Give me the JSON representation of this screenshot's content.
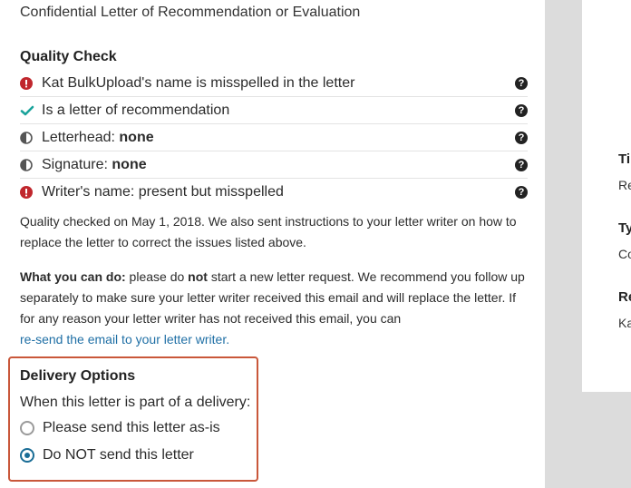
{
  "document": {
    "title": "Confidential Letter of Recommendation or Evaluation"
  },
  "quality_check": {
    "heading": "Quality Check",
    "items": [
      {
        "status": "error",
        "icon": "error-icon",
        "label": "Kat BulkUpload's name is misspelled in the letter",
        "value": ""
      },
      {
        "status": "ok",
        "icon": "checkmark-icon",
        "label": "Is a letter of recommendation",
        "value": ""
      },
      {
        "status": "neutral",
        "icon": "half-circle-icon",
        "label": "Letterhead: ",
        "value": "none"
      },
      {
        "status": "neutral",
        "icon": "half-circle-icon",
        "label": "Signature: ",
        "value": "none"
      },
      {
        "status": "error",
        "icon": "error-icon",
        "label": "Writer's name: present but misspelled",
        "value": ""
      }
    ],
    "help_glyph": "?",
    "checked_text": "Quality checked on May 1, 2018. We also sent instructions to your letter writer on how to replace the letter to correct the issues listed above."
  },
  "what_you_can_do": {
    "lead": "What you can do:",
    "part1": " please do ",
    "emphasis": "not",
    "part2": " start a new letter request. We recommend you follow up separately to make sure your letter writer received this email and will replace the letter. If for any reason your letter writer has not received this email, you can",
    "link": "re-send the email to your letter writer."
  },
  "delivery_options": {
    "heading": "Delivery Options",
    "prompt": "When this letter is part of a delivery:",
    "options": [
      {
        "label": "Please send this letter as-is",
        "selected": false
      },
      {
        "label": "Do NOT send this letter",
        "selected": true
      }
    ]
  },
  "side_panel": {
    "fields": [
      {
        "label": "Ti",
        "value": "Re"
      },
      {
        "label": "Ty",
        "value": "Co"
      },
      {
        "label": "Re",
        "value": "Ka"
      }
    ]
  },
  "colors": {
    "error": "#c0272d",
    "ok": "#1aa39b",
    "link": "#1f6fa5",
    "highlight_border": "#c9573a",
    "radio_selected": "#1a6d96"
  }
}
